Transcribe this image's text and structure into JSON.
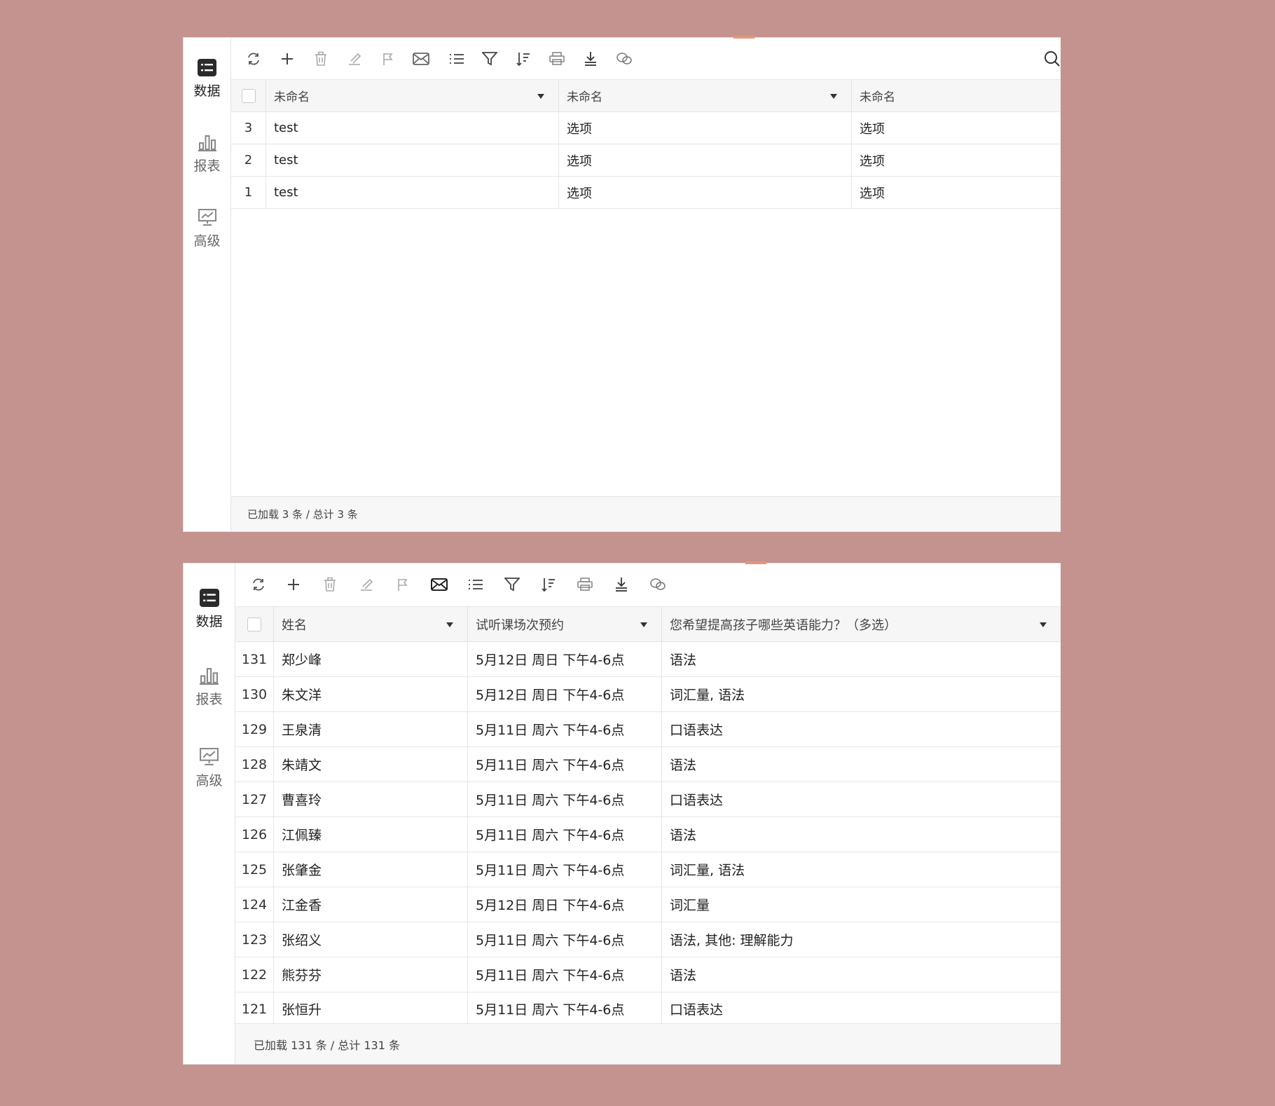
{
  "sidebar": {
    "items": [
      {
        "label": "数据",
        "icon": "list-icon",
        "active": true
      },
      {
        "label": "报表",
        "icon": "bar-chart-icon",
        "active": false
      },
      {
        "label": "高级",
        "icon": "presentation-chart-icon",
        "active": false
      }
    ]
  },
  "toolbar": {
    "buttons": [
      "refresh-icon",
      "add-icon",
      "delete-icon",
      "edit-icon",
      "flag-icon",
      "mail-icon",
      "list-icon",
      "filter-icon",
      "sort-icon",
      "print-icon",
      "download-icon",
      "wechat-icon"
    ],
    "search_icon": "search-icon"
  },
  "panel1": {
    "columns": [
      "未命名",
      "未命名",
      "未命名"
    ],
    "rows": [
      {
        "id": "3",
        "cells": [
          "test",
          "选项",
          "选项"
        ]
      },
      {
        "id": "2",
        "cells": [
          "test",
          "选项",
          "选项"
        ]
      },
      {
        "id": "1",
        "cells": [
          "test",
          "选项",
          "选项"
        ]
      }
    ],
    "footer": "已加载 3 条 / 总计 3 条"
  },
  "panel2": {
    "columns": [
      "姓名",
      "试听课场次预约",
      "您希望提高孩子哪些英语能力？（多选）"
    ],
    "rows": [
      {
        "id": "131",
        "cells": [
          "郑少峰",
          "5月12日 周日 下午4-6点",
          "语法"
        ]
      },
      {
        "id": "130",
        "cells": [
          "朱文洋",
          "5月12日 周日 下午4-6点",
          "词汇量, 语法"
        ]
      },
      {
        "id": "129",
        "cells": [
          "王泉清",
          "5月11日 周六 下午4-6点",
          "口语表达"
        ]
      },
      {
        "id": "128",
        "cells": [
          "朱靖文",
          "5月11日 周六 下午4-6点",
          "语法"
        ]
      },
      {
        "id": "127",
        "cells": [
          "曹喜玲",
          "5月11日 周六 下午4-6点",
          "口语表达"
        ]
      },
      {
        "id": "126",
        "cells": [
          "江佩臻",
          "5月11日 周六 下午4-6点",
          "语法"
        ]
      },
      {
        "id": "125",
        "cells": [
          "张肇金",
          "5月11日 周六 下午4-6点",
          "词汇量, 语法"
        ]
      },
      {
        "id": "124",
        "cells": [
          "江金香",
          "5月12日 周日 下午4-6点",
          "词汇量"
        ]
      },
      {
        "id": "123",
        "cells": [
          "张绍义",
          "5月11日 周六 下午4-6点",
          "语法, 其他: 理解能力"
        ]
      },
      {
        "id": "122",
        "cells": [
          "熊芬芬",
          "5月11日 周六 下午4-6点",
          "语法"
        ]
      },
      {
        "id": "121",
        "cells": [
          "张恒升",
          "5月11日 周六 下午4-6点",
          "口语表达"
        ]
      }
    ],
    "footer": "已加载 131 条 / 总计 131 条"
  }
}
